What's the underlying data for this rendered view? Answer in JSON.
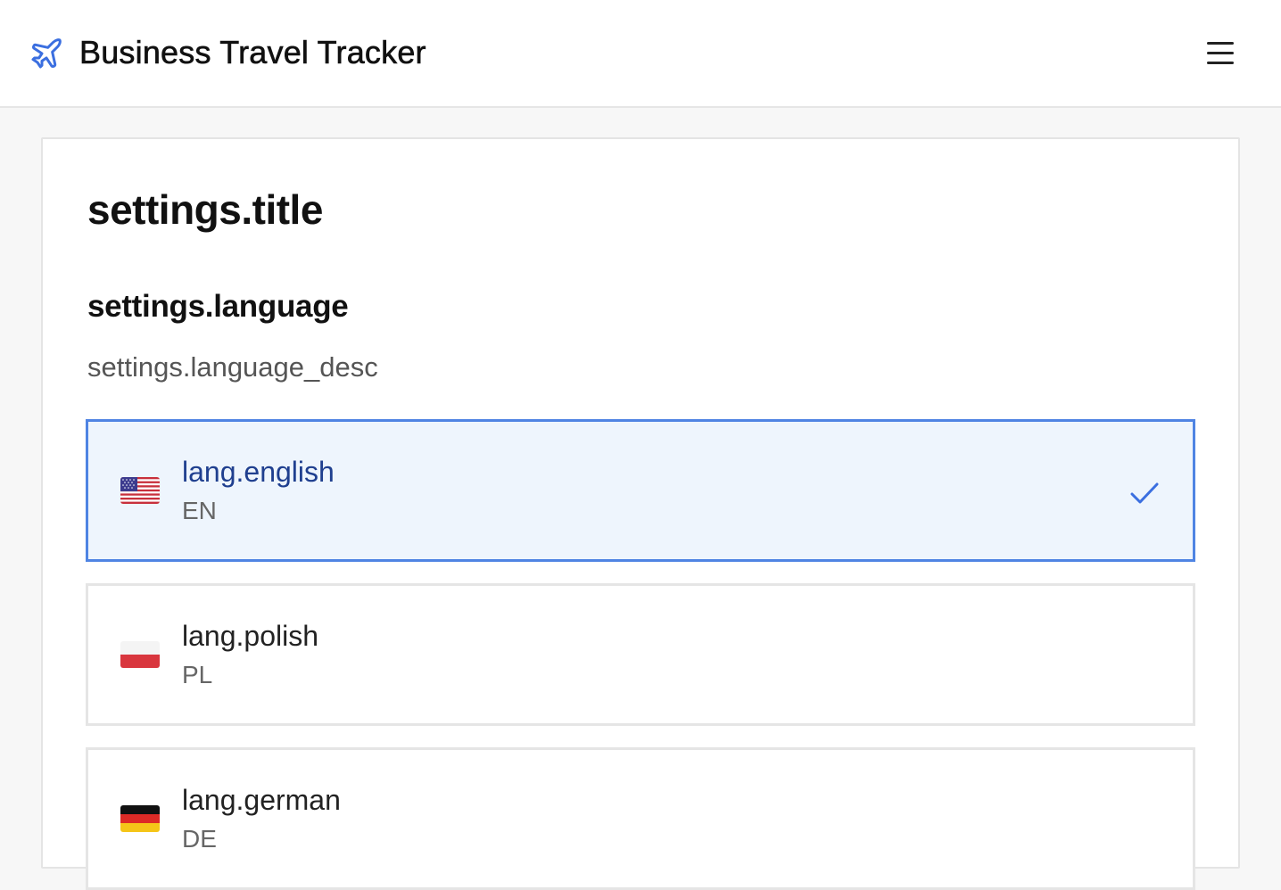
{
  "header": {
    "title": "Business Travel Tracker",
    "brand_icon": "airplane-icon",
    "menu_icon": "hamburger-menu-icon"
  },
  "settings": {
    "title": "settings.title",
    "language_heading": "settings.language",
    "language_desc": "settings.language_desc",
    "languages": [
      {
        "label": "lang.english",
        "code": "EN",
        "flag": "flag-us-icon",
        "selected": true
      },
      {
        "label": "lang.polish",
        "code": "PL",
        "flag": "flag-pl-icon",
        "selected": false
      },
      {
        "label": "lang.german",
        "code": "DE",
        "flag": "flag-de-icon",
        "selected": false
      }
    ]
  },
  "colors": {
    "accent": "#4f84e3",
    "selected_bg": "#eef5fd",
    "selected_text": "#1f3f8f"
  }
}
